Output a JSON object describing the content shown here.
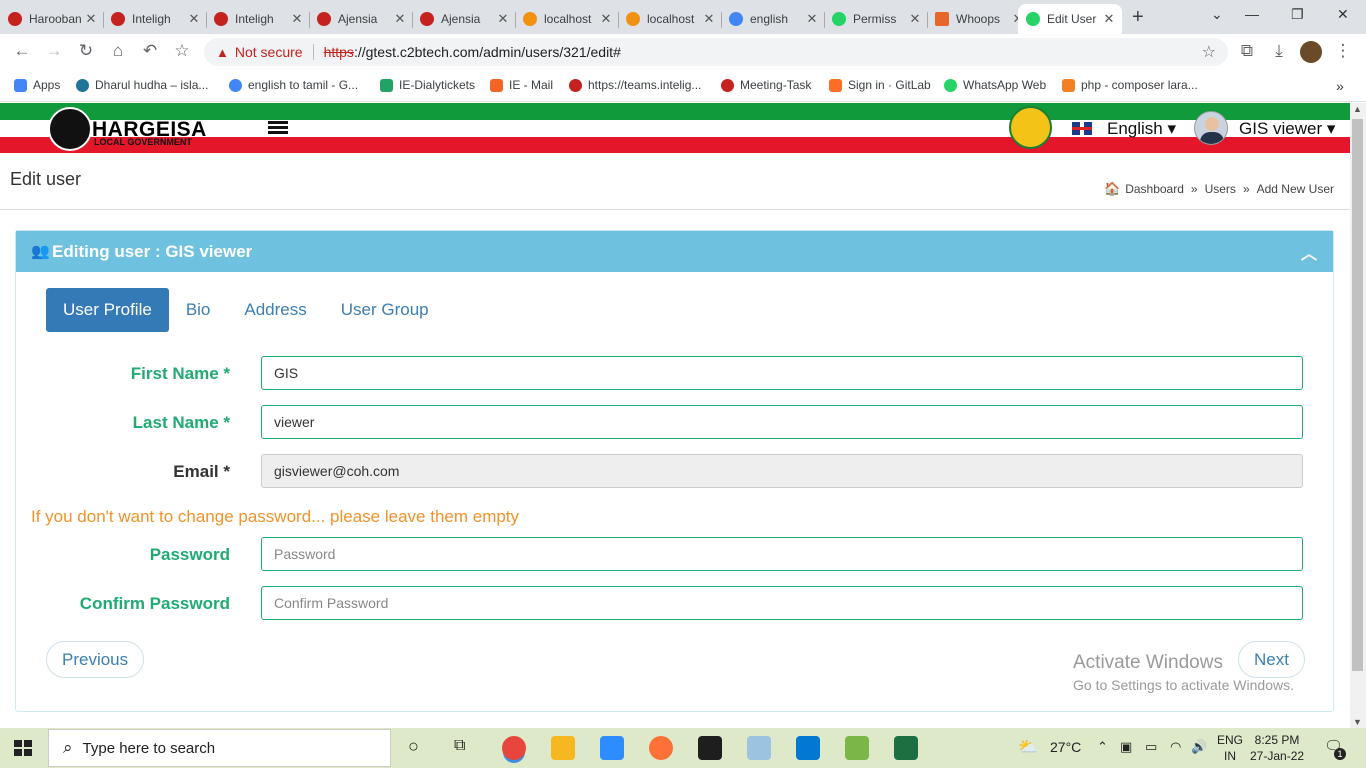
{
  "browser": {
    "tabs": [
      {
        "title": "Harooban",
        "color": "#c5221f"
      },
      {
        "title": "Inteligh",
        "color": "#c5221f"
      },
      {
        "title": "Inteligh",
        "color": "#c5221f"
      },
      {
        "title": "Ajensia",
        "color": "#c5221f"
      },
      {
        "title": "Ajensia",
        "color": "#c5221f"
      },
      {
        "title": "localhost",
        "color": "#f29111"
      },
      {
        "title": "localhost",
        "color": "#f29111"
      },
      {
        "title": "english",
        "color": "#4285f4"
      },
      {
        "title": "Permiss",
        "color": "#25d366"
      },
      {
        "title": "Whoops",
        "color": "#e8652b"
      },
      {
        "title": "Edit User",
        "color": "#25d366"
      }
    ],
    "not_secure": "Not secure",
    "url_protocol": "https",
    "url_rest": "://gtest.c2btech.com/admin/users/321/edit#",
    "bookmarks": [
      {
        "label": "Apps",
        "color": "#4285f4"
      },
      {
        "label": "Dharul hudha – isla...",
        "color": "#21759b"
      },
      {
        "label": "english to tamil - G...",
        "color": "#4285f4"
      },
      {
        "label": "IE-Dialytickets",
        "color": "#21a366"
      },
      {
        "label": "IE - Mail",
        "color": "#f26522"
      },
      {
        "label": "https://teams.intelig...",
        "color": "#c5221f"
      },
      {
        "label": "Meeting-Task",
        "color": "#c5221f"
      },
      {
        "label": "Sign in · GitLab",
        "color": "#fc6d26"
      },
      {
        "label": "WhatsApp Web",
        "color": "#25d366"
      },
      {
        "label": "php - composer lara...",
        "color": "#f48024"
      }
    ]
  },
  "header": {
    "brand": "HARGEISA",
    "brand_sub": "LOCAL GOVERNMENT",
    "language": "English ▾",
    "user": "GIS viewer ▾"
  },
  "page": {
    "title": "Edit user",
    "breadcrumb": [
      "Dashboard",
      "Users",
      "Add New User"
    ]
  },
  "card": {
    "title": "Editing user : GIS viewer",
    "tabs": [
      "User Profile",
      "Bio",
      "Address",
      "User Group"
    ]
  },
  "form": {
    "first_name_label": "First Name *",
    "first_name_value": "GIS",
    "last_name_label": "Last Name *",
    "last_name_value": "viewer",
    "email_label": "Email *",
    "email_value": "gisviewer@coh.com",
    "password_hint": "If you don't want to change password... please leave them empty",
    "password_label": "Password",
    "password_placeholder": "Password",
    "confirm_label": "Confirm Password",
    "confirm_placeholder": "Confirm Password",
    "previous": "Previous",
    "next": "Next"
  },
  "watermark": {
    "line1": "Activate Windows",
    "line2": "Go to Settings to activate Windows."
  },
  "taskbar": {
    "search_placeholder": "Type here to search",
    "temperature": "27°C",
    "lang1": "ENG",
    "lang2": "IN",
    "time": "8:25 PM",
    "date": "27-Jan-22",
    "notification_count": "1"
  }
}
